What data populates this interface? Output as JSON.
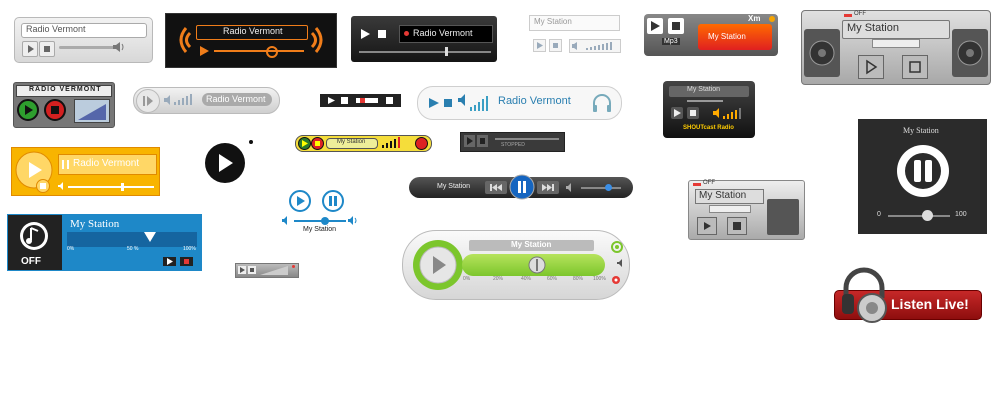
{
  "players": {
    "p1": {
      "station": "Radio Vermont"
    },
    "p2": {
      "station": "Radio Vermont"
    },
    "p3": {
      "station": "Radio Vermont"
    },
    "p4": {
      "station": "My Station"
    },
    "p5": {
      "brand": "Xm",
      "format": "Mp3",
      "station": "My Station"
    },
    "p6": {
      "off_label": "OFF",
      "station": "My Station"
    },
    "p7": {
      "title": "RADIO VERMONT"
    },
    "p8": {
      "station": "Radio Vermont"
    },
    "p10": {
      "station": "Radio Vermont"
    },
    "p11": {
      "station": "My Station",
      "brand": "SHOUTcast Radio"
    },
    "p12": {
      "station": "My Station"
    },
    "p13": {
      "status": "STOPPED"
    },
    "p14": {
      "station": "Radio Vermont"
    },
    "p16": {
      "station": "My Station"
    },
    "p17": {
      "station": "My Station"
    },
    "p18": {
      "off_label": "OFF",
      "station": "My Station"
    },
    "p19": {
      "station": "My Station",
      "min": "0",
      "max": "100"
    },
    "p20": {
      "station": "My Station",
      "off_label": "OFF",
      "scale_min": "0%",
      "scale_mid": "50 %",
      "scale_max": "100%"
    },
    "p22": {
      "station": "My Station",
      "ticks": [
        "0%",
        "20%",
        "40%",
        "60%",
        "80%",
        "100%"
      ]
    },
    "p23": {
      "label": "Listen Live!"
    }
  },
  "colors": {
    "orange": "#f39c12",
    "blue": "#1e88c8",
    "green": "#7cc62c",
    "red": "#e53935",
    "dark": "#2b2b2b"
  }
}
